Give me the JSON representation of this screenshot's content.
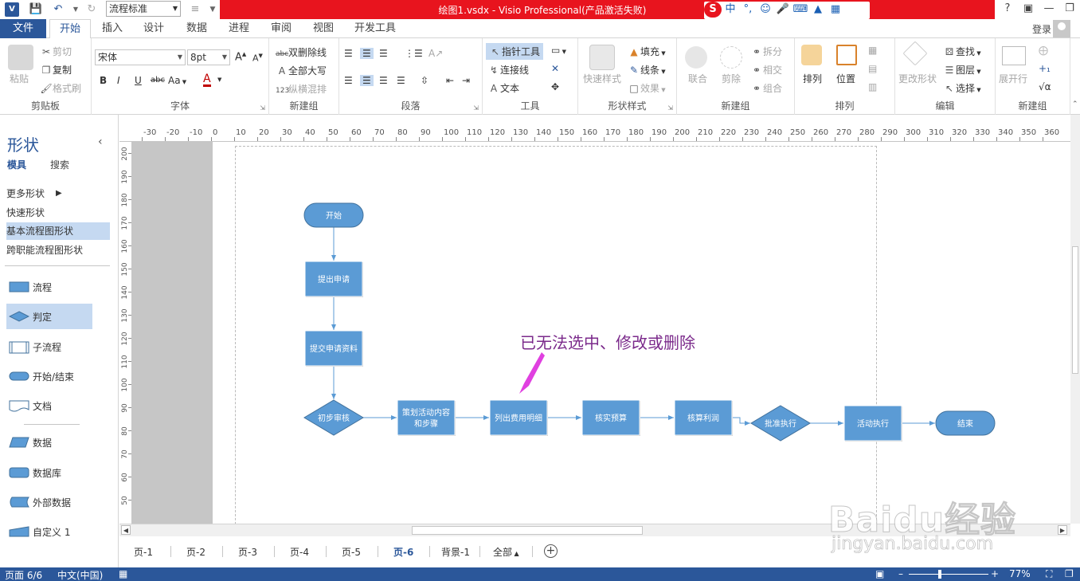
{
  "titlebar": {
    "title": "绘图1.vsdx -  Visio Professional(产品激活失败)",
    "style_combo": "流程标准",
    "app_icon_text": "V"
  },
  "tabs": {
    "file": "文件",
    "items": [
      "开始",
      "插入",
      "设计",
      "数据",
      "进程",
      "审阅",
      "视图",
      "开发工具"
    ],
    "login": "登录"
  },
  "ribbon": {
    "clipboard": {
      "label": "剪贴板",
      "paste": "粘贴",
      "cut": "剪切",
      "copy": "复制",
      "format_painter": "格式刷"
    },
    "font": {
      "label": "字体",
      "name": "宋体",
      "size": "8pt",
      "aa": "Aa"
    },
    "new_group1": {
      "label": "新建组",
      "strike": "双删除线",
      "caps": "全部大写",
      "mixed": "纵横混排"
    },
    "paragraph": {
      "label": "段落"
    },
    "tools": {
      "label": "工具",
      "pointer": "指针工具",
      "connector": "连接线",
      "text": "文本"
    },
    "shape_style": {
      "label": "形状样式",
      "quick": "快速样式",
      "fill": "填充",
      "line": "线条",
      "effect": "效果"
    },
    "new_group2": {
      "label": "新建组",
      "union": "联合",
      "fragment": "剪除",
      "split": "拆分",
      "intersect": "相交",
      "combine": "组合"
    },
    "arrange": {
      "label": "排列",
      "arrange": "排列",
      "position": "位置"
    },
    "edit": {
      "label": "编辑",
      "change_shape": "更改形状",
      "find": "查找",
      "layers": "图层",
      "select": "选择"
    },
    "new_group3": {
      "label": "新建组",
      "expand": "展开行"
    }
  },
  "shapes_pane": {
    "title": "形状",
    "tab_stencil": "模具",
    "tab_search": "搜索",
    "more_shapes": "更多形状",
    "quick_shapes": "快速形状",
    "basic_flowchart": "基本流程图形状",
    "cross_functional": "跨职能流程图形状",
    "shapes": [
      {
        "label": "流程"
      },
      {
        "label": "判定"
      },
      {
        "label": "子流程"
      },
      {
        "label": "开始/结束"
      },
      {
        "label": "文档"
      },
      {
        "label": "数据"
      },
      {
        "label": "数据库"
      },
      {
        "label": "外部数据"
      },
      {
        "label": "自定义 1"
      }
    ]
  },
  "ruler_h": [
    "-30",
    "-20",
    "-10",
    "0",
    "10",
    "20",
    "30",
    "40",
    "50",
    "60",
    "70",
    "80",
    "90",
    "100",
    "110",
    "120",
    "130",
    "140",
    "150",
    "160",
    "170",
    "180",
    "190",
    "200",
    "210",
    "220",
    "230",
    "240",
    "250",
    "260",
    "270",
    "280",
    "290",
    "300",
    "310",
    "320",
    "330",
    "340",
    "350",
    "360"
  ],
  "ruler_v": [
    "200",
    "190",
    "180",
    "170",
    "160",
    "150",
    "140",
    "130",
    "120",
    "110",
    "100",
    "90",
    "80",
    "70",
    "60",
    "50"
  ],
  "flowchart": {
    "nodes": [
      {
        "id": "start",
        "text": "开始",
        "kind": "terminator"
      },
      {
        "id": "n1",
        "text": "提出申请",
        "kind": "process"
      },
      {
        "id": "n2",
        "text": "提交申请资料",
        "kind": "process"
      },
      {
        "id": "n3",
        "text": "初步审核",
        "kind": "decision"
      },
      {
        "id": "n4",
        "text": "策划活动内容",
        "text2": "和步骤",
        "kind": "process"
      },
      {
        "id": "n5",
        "text": "列出费用明细",
        "kind": "process"
      },
      {
        "id": "n6",
        "text": "核实预算",
        "kind": "process"
      },
      {
        "id": "n7",
        "text": "核算利润",
        "kind": "process"
      },
      {
        "id": "n8",
        "text": "批准执行",
        "kind": "decision"
      },
      {
        "id": "n9",
        "text": "活动执行",
        "kind": "process"
      },
      {
        "id": "end",
        "text": "结束",
        "kind": "terminator"
      }
    ],
    "annotation": "已无法选中、修改或删除",
    "colors": {
      "shape_fill": "#5b9bd5",
      "shape_stroke": "#41719c",
      "connector": "#5b9bd5",
      "annotation": "#7b2a8b",
      "arrow": "#e040e0"
    }
  },
  "page_tabs": [
    "页-1",
    "页-2",
    "页-3",
    "页-4",
    "页-5",
    "页-6",
    "背景-1",
    "全部"
  ],
  "active_page": "页-6",
  "statusbar": {
    "page": "页面 6/6",
    "lang": "中文(中国)",
    "zoom": "77%"
  },
  "watermark": {
    "logo": "Baidu经验",
    "url": "jingyan.baidu.com"
  },
  "colors": {
    "accent": "#2b579a",
    "title_red": "#e8141e"
  }
}
